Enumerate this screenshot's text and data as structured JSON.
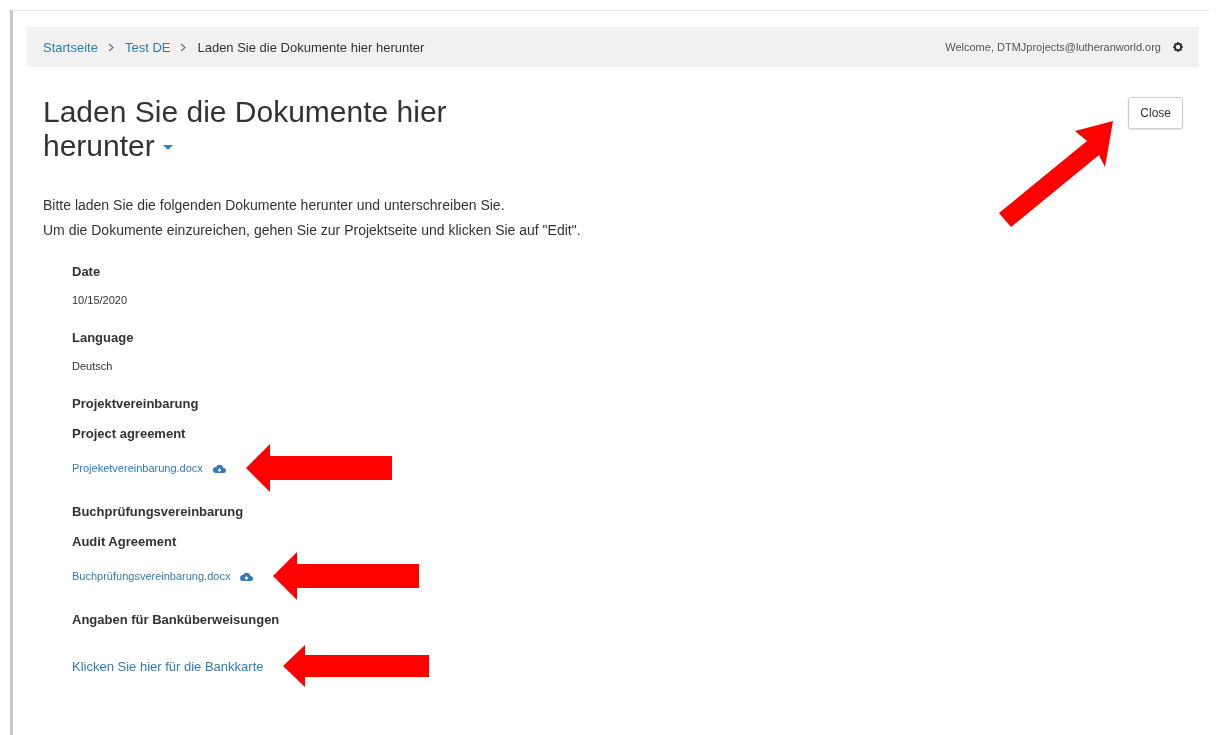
{
  "breadcrumb": [
    {
      "label": "Startseite",
      "kind": "link"
    },
    {
      "label": "Test DE",
      "kind": "link"
    },
    {
      "label": "Laden Sie die Dokumente hier herunter",
      "kind": "current"
    }
  ],
  "welcome": "Welcome, DTMJprojects@lutheranworld.org",
  "title": "Laden Sie die Dokumente hier herunter",
  "close_button": {
    "label": "Close",
    "arrow": true
  },
  "intro": [
    "Bitte laden Sie die folgenden Dokumente herunter und unterschreiben Sie.",
    "Um die Dokumente einzureichen, gehen Sie zur Projektseite und klicken Sie auf \"Edit\"."
  ],
  "fields": [
    {
      "kind": "text",
      "label": "Date",
      "value": "10/15/2020"
    },
    {
      "kind": "text",
      "label": "Language",
      "value": "Deutsch"
    },
    {
      "kind": "file",
      "label": "Projektvereinbarung",
      "sublabel": "Project agreement",
      "link": "Projeketvereinbarung.docx",
      "arrow": true
    },
    {
      "kind": "file",
      "label": "Buchprüfungsvereinbarung",
      "sublabel": "Audit Agreement",
      "link": "Buchprüfungsvereinbarung.docx",
      "arrow": true
    },
    {
      "kind": "link",
      "label": "Angaben für Banküberweisungen",
      "link": "Klicken Sie hier für die Bankkarte",
      "arrow": true
    }
  ]
}
